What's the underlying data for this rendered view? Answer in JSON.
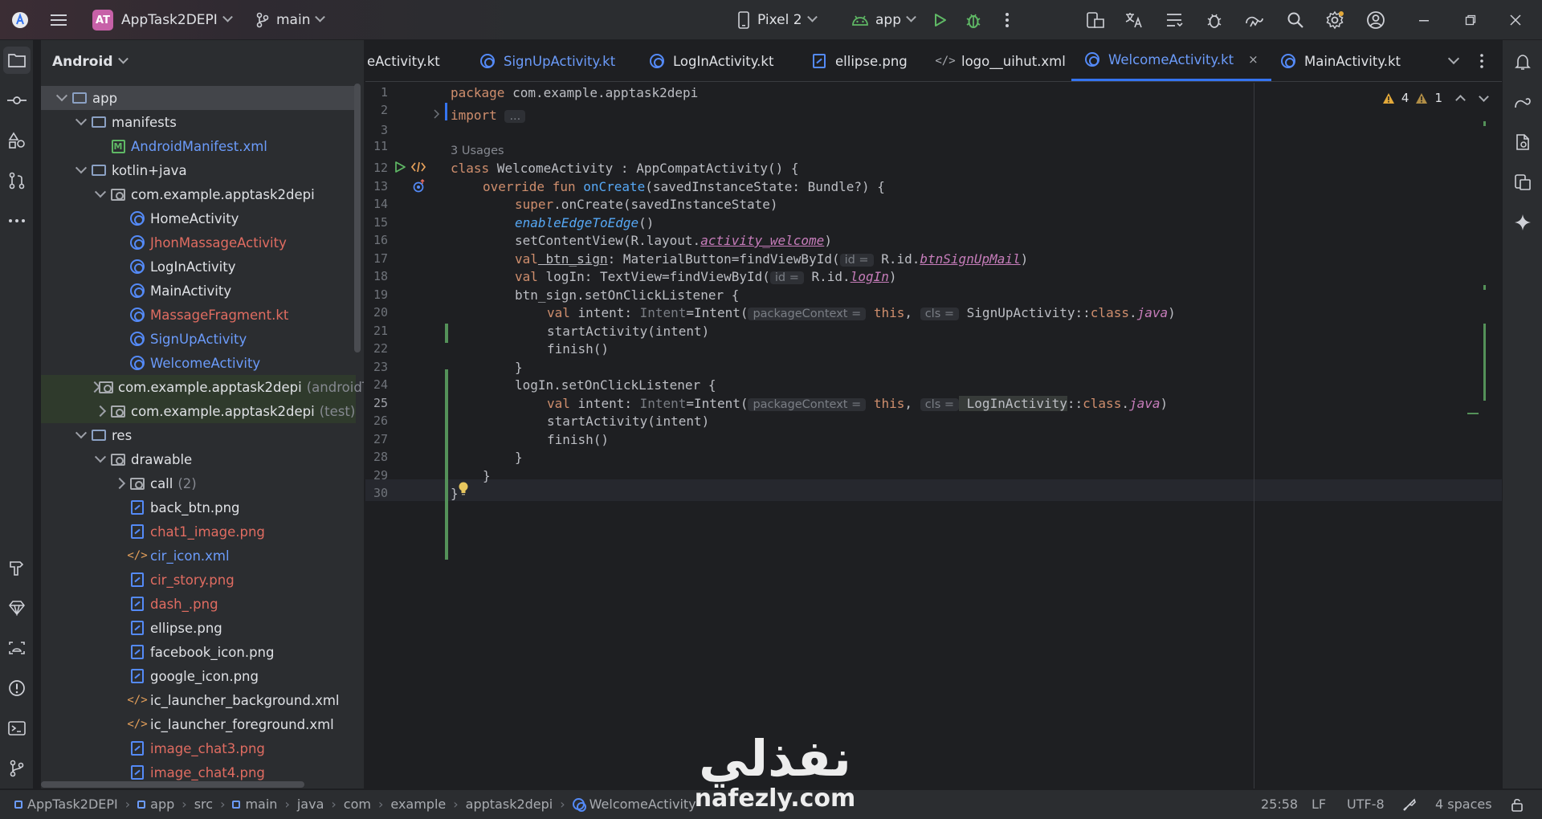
{
  "titlebar": {
    "project_initials": "AT",
    "project_name": "AppTask2DEPI",
    "branch": "main",
    "device": "Pixel 2",
    "run_config": "app"
  },
  "project_panel": {
    "title": "Android",
    "tree": [
      {
        "label": "app",
        "color": "white",
        "icon": "module-folder-icon",
        "depth": 0,
        "expand": "down",
        "selected": true
      },
      {
        "label": "manifests",
        "color": "white",
        "icon": "folder-icon",
        "depth": 1,
        "expand": "down"
      },
      {
        "label": "AndroidManifest.xml",
        "color": "blue",
        "icon": "manifest-icon",
        "depth": 2
      },
      {
        "label": "kotlin+java",
        "color": "white",
        "icon": "folder-icon",
        "depth": 1,
        "expand": "down"
      },
      {
        "label": "com.example.apptask2depi",
        "color": "white",
        "icon": "package-icon",
        "depth": 2,
        "expand": "down"
      },
      {
        "label": "HomeActivity",
        "color": "white",
        "icon": "kotlin-class-icon",
        "depth": 3
      },
      {
        "label": "JhonMassageActivity",
        "color": "red",
        "icon": "kotlin-class-icon",
        "depth": 3
      },
      {
        "label": "LogInActivity",
        "color": "white",
        "icon": "kotlin-class-icon",
        "depth": 3
      },
      {
        "label": "MainActivity",
        "color": "white",
        "icon": "kotlin-class-icon",
        "depth": 3
      },
      {
        "label": "MassageFragment.kt",
        "color": "red",
        "icon": "kotlin-class-icon",
        "depth": 3
      },
      {
        "label": "SignUpActivity",
        "color": "blue",
        "icon": "kotlin-class-icon",
        "depth": 3
      },
      {
        "label": "WelcomeActivity",
        "color": "blue",
        "icon": "kotlin-class-icon",
        "depth": 3
      },
      {
        "label": "com.example.apptask2depi",
        "suffix": "(androidT",
        "color": "white",
        "icon": "package-icon",
        "depth": 2,
        "expand": "right",
        "green": true
      },
      {
        "label": "com.example.apptask2depi",
        "suffix": "(test)",
        "color": "white",
        "icon": "package-icon",
        "depth": 2,
        "expand": "right",
        "green": true
      },
      {
        "label": "res",
        "color": "white",
        "icon": "res-folder-icon",
        "depth": 1,
        "expand": "down"
      },
      {
        "label": "drawable",
        "color": "white",
        "icon": "package-icon",
        "depth": 2,
        "expand": "down"
      },
      {
        "label": "call",
        "suffix": "(2)",
        "color": "white",
        "icon": "package-icon",
        "depth": 3,
        "expand": "right"
      },
      {
        "label": "back_btn.png",
        "color": "white",
        "icon": "image-file-icon",
        "depth": 3
      },
      {
        "label": "chat1_image.png",
        "color": "red",
        "icon": "image-file-icon",
        "depth": 3
      },
      {
        "label": "cir_icon.xml",
        "color": "blue",
        "icon": "xml-file-icon",
        "depth": 3
      },
      {
        "label": "cir_story.png",
        "color": "red",
        "icon": "image-file-icon",
        "depth": 3
      },
      {
        "label": "dash_.png",
        "color": "red",
        "icon": "image-file-icon",
        "depth": 3
      },
      {
        "label": "ellipse.png",
        "color": "white",
        "icon": "image-file-icon",
        "depth": 3
      },
      {
        "label": "facebook_icon.png",
        "color": "white",
        "icon": "image-file-icon",
        "depth": 3
      },
      {
        "label": "google_icon.png",
        "color": "white",
        "icon": "image-file-icon",
        "depth": 3
      },
      {
        "label": "ic_launcher_background.xml",
        "color": "white",
        "icon": "xml-file-icon",
        "depth": 3
      },
      {
        "label": "ic_launcher_foreground.xml",
        "color": "white",
        "icon": "xml-file-icon",
        "depth": 3
      },
      {
        "label": "image_chat3.png",
        "color": "red",
        "icon": "image-file-icon",
        "depth": 3
      },
      {
        "label": "image_chat4.png",
        "color": "red",
        "icon": "image-file-icon",
        "depth": 3
      }
    ]
  },
  "tabs": [
    {
      "label": "eActivity.kt",
      "color": "white",
      "icon": "kotlin-class-icon"
    },
    {
      "label": "SignUpActivity.kt",
      "color": "blue",
      "icon": "kotlin-class-icon"
    },
    {
      "label": "LogInActivity.kt",
      "color": "white",
      "icon": "kotlin-class-icon"
    },
    {
      "label": "ellipse.png",
      "color": "white",
      "icon": "image-file-icon"
    },
    {
      "label": "logo__uihut.xml",
      "color": "white",
      "icon": "xml-file-icon"
    },
    {
      "label": "WelcomeActivity.kt",
      "color": "blue",
      "icon": "kotlin-class-icon",
      "active": true
    },
    {
      "label": "MainActivity.kt",
      "color": "white",
      "icon": "kotlin-class-icon"
    }
  ],
  "inspections": {
    "warnings": "4",
    "weak_warnings": "1"
  },
  "editor": {
    "usages": "3 Usages",
    "line_numbers": [
      "1",
      "2",
      "3",
      "11",
      "12",
      "13",
      "14",
      "15",
      "16",
      "17",
      "18",
      "19",
      "20",
      "21",
      "22",
      "23",
      "24",
      "25",
      "26",
      "27",
      "28",
      "29",
      "30"
    ],
    "current_line": "25",
    "code": {
      "l1_kw": "package",
      "l1_rest": " com.example.apptask2depi",
      "l3_kw": "import",
      "l3_fold": "...",
      "l12_kw": "class",
      "l12_rest": " WelcomeActivity : AppCompatActivity() {",
      "l13_kw": "override fun",
      "l13_fn": "onCreate",
      "l13_rest": "(savedInstanceState: Bundle?) {",
      "l14_kw": "super",
      "l14_rest": ".onCreate(savedInstanceState)",
      "l15_fn": "enableEdgeToEdge",
      "l15_rest": "()",
      "l16_a": "setContentView(R.layout.",
      "l16_prop": "activity_welcome",
      "l16_b": ")",
      "l17_kw": "val",
      "l17_var": " btn_sign",
      "l17_a": ": MaterialButton=findViewById(",
      "l17_hint": "id =",
      "l17_b": " R.id.",
      "l17_prop": "btnSignUpMail",
      "l17_c": ")",
      "l18_kw": "val",
      "l18_a": " logIn: TextView=findViewById(",
      "l18_hint": "id =",
      "l18_b": " R.id.",
      "l18_prop": "logIn",
      "l18_c": ")",
      "l19": "btn_sign.setOnClickListener {",
      "l20_kw": "val",
      "l20_a": " intent: ",
      "l20_type": "Intent",
      "l20_b": "=Intent(",
      "l20_hint1": "packageContext =",
      "l20_this": "this",
      "l20_c": ",",
      "l20_hint2": "cls =",
      "l20_d": " SignUpActivity::",
      "l20_kw2": "class",
      "l20_e": ".",
      "l20_java": "java",
      "l20_f": ")",
      "l21": "startActivity(intent)",
      "l22": "finish()",
      "l23": "}",
      "l24": "logIn.setOnClickListener {",
      "l25_kw": "val",
      "l25_a": " intent: ",
      "l25_type": "Intent",
      "l25_b": "=Intent(",
      "l25_hint1": "packageContext =",
      "l25_this": "this",
      "l25_c": ",",
      "l25_hint2": "cls =",
      "l25_d": " LogInActivity",
      "l25_e": "::",
      "l25_kw2": "class",
      "l25_f": ".",
      "l25_java": "java",
      "l25_g": ")",
      "l26": "startActivity(intent)",
      "l27": "finish()",
      "l28": "}",
      "l29": "}",
      "l30": "}"
    }
  },
  "statusbar": {
    "breadcrumbs": [
      "AppTask2DEPI",
      "app",
      "src",
      "main",
      "java",
      "com",
      "example",
      "apptask2depi",
      "WelcomeActivity"
    ],
    "position": "25:58",
    "line_sep": "LF",
    "encoding": "UTF-8",
    "indent": "4 spaces"
  },
  "watermark": {
    "arabic": "نفذلي",
    "latin": "nafezly.com"
  },
  "colors": {
    "accent": "#3574f0",
    "kotlin_blue": "#548af7",
    "red_file": "#e06c61",
    "warning": "#e3a93a"
  }
}
